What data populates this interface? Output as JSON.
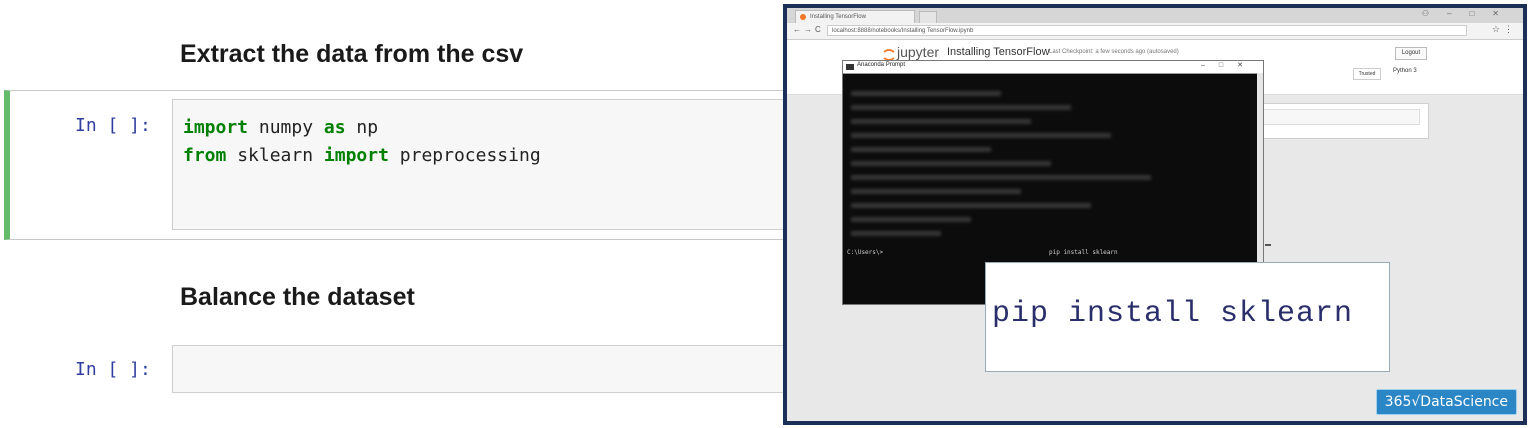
{
  "notebook": {
    "heading1": "Extract the data from the csv",
    "heading2": "Balance the dataset",
    "cell1": {
      "prompt": "In [ ]:",
      "line1": {
        "kw1": "import",
        "t1": " numpy ",
        "kw2": "as",
        "t2": " np"
      },
      "line2": {
        "kw1": "from",
        "t1": " sklearn ",
        "kw2": "import",
        "t2": " preprocessing"
      }
    },
    "cell2": {
      "prompt": "In [ ]:"
    }
  },
  "video": {
    "browser": {
      "tab_title": "Installing TensorFlow",
      "url": "localhost:8888/notebooks/Installing TensorFlow.ipynb"
    },
    "jupyter": {
      "brand": "jupyter",
      "notebook_title": "Installing TensorFlow",
      "checkpoint": "Last Checkpoint: a few seconds ago (autosaved)",
      "logout_label": "Logout",
      "trusted_label": "Trusted",
      "kernel_label": "Python 3"
    },
    "terminal": {
      "title": "Anaconda Prompt",
      "prompt": "C:\\Users\\>",
      "command": "pip install sklearn"
    },
    "zoom_text": "pip install sklearn",
    "brand_badge": "365√DataScience"
  },
  "colors": {
    "cell_selected": "#66bb6a",
    "keyword": "#008000",
    "prompt": "#303f9f",
    "video_border": "#1c2f56",
    "badge": "#2b86c5"
  }
}
